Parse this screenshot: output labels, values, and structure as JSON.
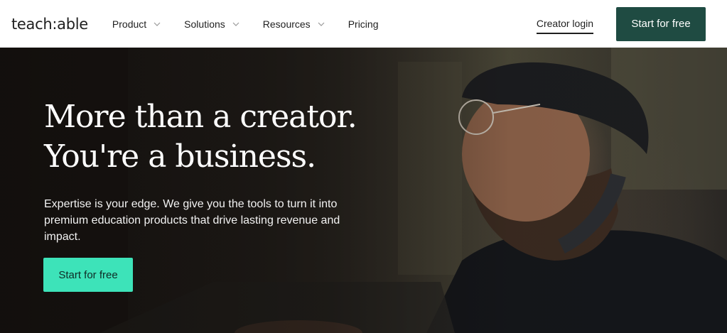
{
  "nav": {
    "logo": "teach:able",
    "items": [
      {
        "label": "Product",
        "has_dropdown": true
      },
      {
        "label": "Solutions",
        "has_dropdown": true
      },
      {
        "label": "Resources",
        "has_dropdown": true
      },
      {
        "label": "Pricing",
        "has_dropdown": false
      }
    ],
    "login_label": "Creator login",
    "cta_label": "Start for free"
  },
  "hero": {
    "headline_line1": "More than a creator.",
    "headline_line2": "You're a business.",
    "subtext": "Expertise is your edge. We give you the tools to turn it into premium education products that drive lasting revenue and impact.",
    "cta_label": "Start for free"
  },
  "colors": {
    "nav_cta_bg": "#1f4b42",
    "hero_cta_bg": "#3de3b9",
    "hero_bg": "#2a2622"
  }
}
